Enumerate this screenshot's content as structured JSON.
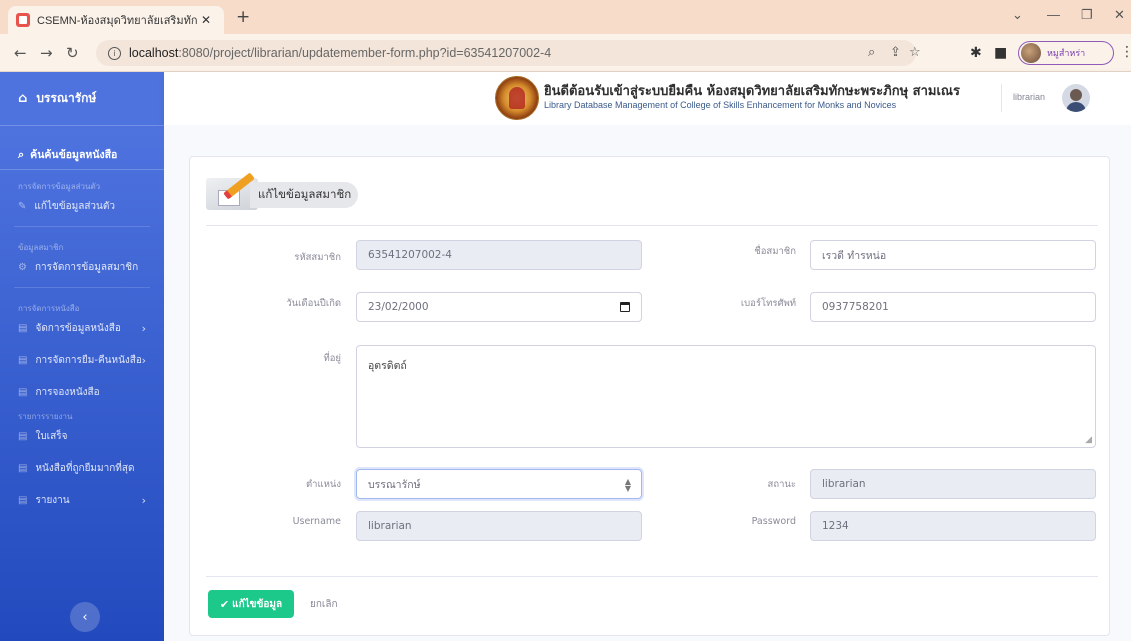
{
  "browser": {
    "tab_title": "CSEMN-ห้องสมุดวิทยาลัยเสริมทักษะ",
    "url_host": "localhost",
    "url_rest": ":8080/project/librarian/updatemember-form.php?id=63541207002-4",
    "profile_name": "หมูสำหร่า",
    "accent_color": "#8e5bb8"
  },
  "sidebar": {
    "brand": "บรรณารักษ์",
    "search_label": "ค้นค้นข้อมูลหนังสือ",
    "heading_profile": "การจัดการข้อมูลส่วนตัว",
    "item_profile": "แก้ไขข้อมูลส่วนตัว",
    "heading_member": "ข้อมูลสมาชิก",
    "item_member": "การจัดการข้อมูลสมาชิก",
    "heading_books": "การจัดการหนังสือ",
    "item_books": "จัดการข้อมูลหนังสือ",
    "item_borrow": "การจัดการยืม-คืนหนังสือ",
    "item_reserve": "การจองหนังสือ",
    "heading_report": "รายการรายงาน",
    "item_fine": "ใบเสร็จ",
    "item_popular": "หนังสือที่ถูกยืมมากที่สุด",
    "item_report": "รายงาน",
    "toggle_icon": "chevron-left-icon",
    "gradient_top": "#4e73df",
    "gradient_bottom": "#224abe"
  },
  "topbar": {
    "title": "ยินดีต้อนรับเข้าสู่ระบบยืมคืน ห้องสมุดวิทยาลัยเสริมทักษะพระภิกษุ สามเณร",
    "subtitle": "Library Database Management of College of Skills Enhancement for Monks and Novices",
    "user_name": "librarian"
  },
  "form": {
    "header": "แก้ไขข้อมูลสมาชิก",
    "member_id_label": "รหัสสมาชิก",
    "member_id_value": "63541207002-4",
    "member_name_label": "ชื่อสมาชิก",
    "member_name_value": "เรวดี ทำรหน่อ",
    "birthdate_label": "วันเดือนปีเกิด",
    "birthdate_value": "23/02/2000",
    "phone_label": "เบอร์โทรศัพท์",
    "phone_value": "0937758201",
    "address_label": "ที่อยู่",
    "address_value": "อุตรดิตถ์",
    "position_label": "ตำแหน่ง",
    "position_value": "บรรณารักษ์",
    "status_label": "สถานะ",
    "status_value": "librarian",
    "username_label": "Username",
    "username_value": "librarian",
    "password_label": "Password",
    "password_value": "1234",
    "submit_label": "แก้ไขข้อมูล",
    "cancel_label": "ยกเลิก",
    "submit_color": "#1cc88a"
  }
}
